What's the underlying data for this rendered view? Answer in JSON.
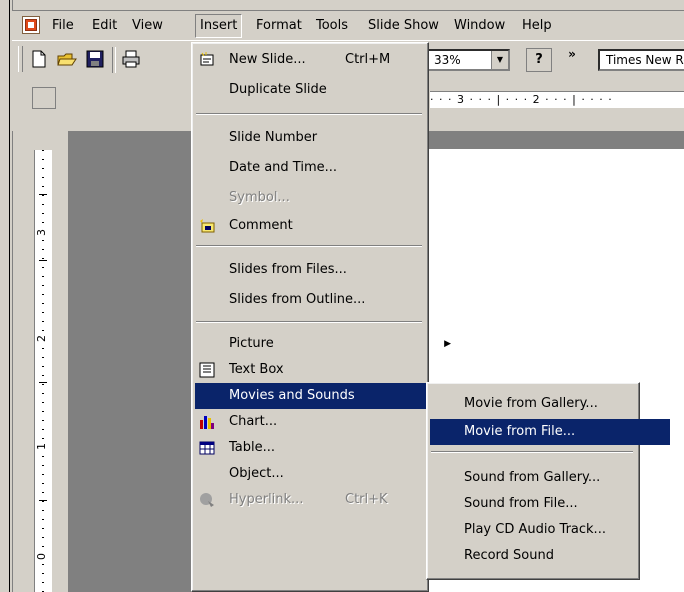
{
  "menubar": {
    "items": [
      {
        "label": "File"
      },
      {
        "label": "Edit"
      },
      {
        "label": "View"
      },
      {
        "label": "Insert"
      },
      {
        "label": "Format"
      },
      {
        "label": "Tools"
      },
      {
        "label": "Slide Show"
      },
      {
        "label": "Window"
      },
      {
        "label": "Help"
      }
    ]
  },
  "toolbar": {
    "zoom_value": "33%",
    "font_name": "Times New Roman",
    "help_label": "?",
    "more_label": "»"
  },
  "ruler": {
    "horizontal_text": "· · · 3 · · · | · · · 2 · · · | · · · ·",
    "vertical_labels": [
      "3",
      "2",
      "1",
      "0"
    ]
  },
  "insert_menu": {
    "items": [
      {
        "label": "New Slide...",
        "shortcut": "Ctrl+M"
      },
      {
        "label": "Duplicate Slide"
      },
      {
        "label": "Slide Number"
      },
      {
        "label": "Date and Time..."
      },
      {
        "label": "Symbol..."
      },
      {
        "label": "Comment"
      },
      {
        "label": "Slides from Files..."
      },
      {
        "label": "Slides from Outline..."
      },
      {
        "label": "Picture"
      },
      {
        "label": "Text Box"
      },
      {
        "label": "Movies and Sounds"
      },
      {
        "label": "Chart..."
      },
      {
        "label": "Table..."
      },
      {
        "label": "Object..."
      },
      {
        "label": "Hyperlink...",
        "shortcut": "Ctrl+K"
      }
    ]
  },
  "movies_submenu": {
    "items": [
      {
        "label": "Movie from Gallery..."
      },
      {
        "label": "Movie from File..."
      },
      {
        "label": "Sound from Gallery..."
      },
      {
        "label": "Sound from File..."
      },
      {
        "label": "Play CD Audio Track..."
      },
      {
        "label": "Record Sound"
      }
    ]
  },
  "colors": {
    "highlight": "#0a246a",
    "face": "#d4d0c8",
    "workspace": "#808080"
  }
}
